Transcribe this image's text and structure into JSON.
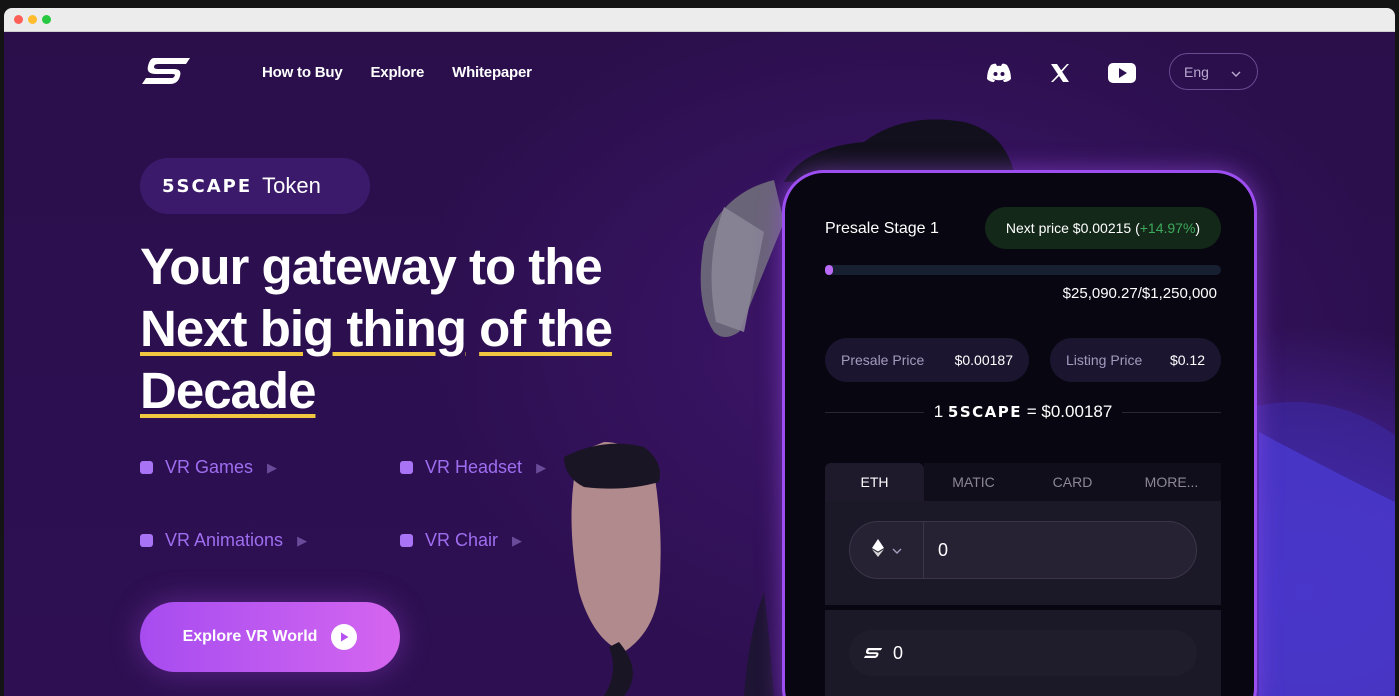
{
  "nav": {
    "items": [
      "How to Buy",
      "Explore",
      "Whitepaper"
    ]
  },
  "social": {
    "icons": [
      "discord-icon",
      "x-icon",
      "youtube-icon"
    ]
  },
  "lang": {
    "label": "Eng"
  },
  "hero": {
    "badge_brand": "5SCAPE",
    "badge_word": "Token",
    "headline_line1": "Your gateway to the",
    "headline_line2a": "Next big thing",
    "headline_line2b": "of the",
    "headline_line3": "Decade",
    "features": [
      "VR Games",
      "VR Headset",
      "VR Animations",
      "VR Chair"
    ],
    "cta_label": "Explore VR World"
  },
  "presale": {
    "stage": "Presale Stage 1",
    "next_price_label": "Next price $0.00215 (",
    "next_price_pct": "+14.97%",
    "next_price_close": ")",
    "progress_fraction": 0.02,
    "raised": "$25,090.27/$1,250,000",
    "presale_price_label": "Presale Price",
    "presale_price_value": "$0.00187",
    "listing_price_label": "Listing Price",
    "listing_price_value": "$0.12",
    "rate_prefix": "1",
    "rate_brand": "5SCAPE",
    "rate_value": "= $0.00187",
    "tabs": [
      "ETH",
      "MATIC",
      "CARD",
      "MORE..."
    ],
    "active_tab": "ETH",
    "pay_amount": "0",
    "receive_amount": "0"
  },
  "colors": {
    "background": "#2a0f49",
    "accent_purple": "#a874f5",
    "underline_yellow": "#f1c640",
    "pct_green": "#3ea95b"
  }
}
